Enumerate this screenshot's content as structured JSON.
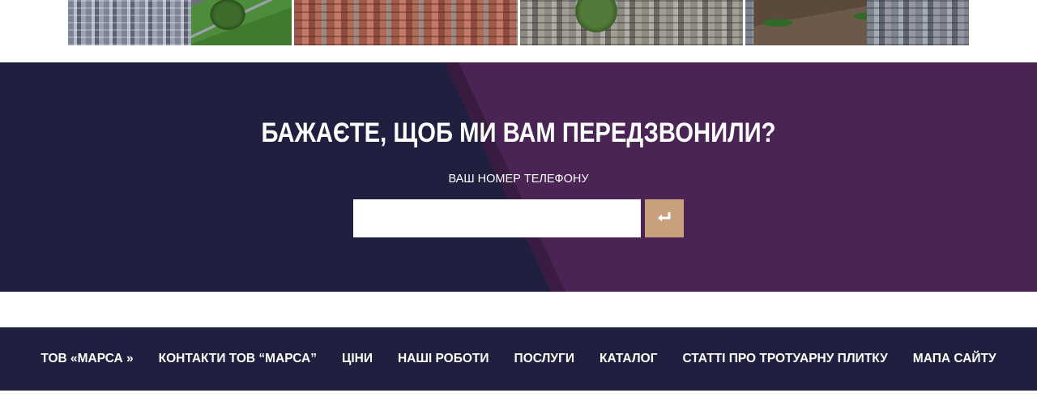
{
  "gallery": {
    "items": [
      {
        "alt_semantic": "paving-photo-gray-with-lawn"
      },
      {
        "alt_semantic": "paving-photo-red-brick"
      },
      {
        "alt_semantic": "paving-photo-gray-with-tree"
      },
      {
        "alt_semantic": "paving-photo-gray-with-shrubs"
      }
    ]
  },
  "callback": {
    "title": "БАЖАЄТЕ, ЩОБ МИ ВАМ ПЕРЕДЗВОНИЛИ?",
    "phone_label": "ВАШ НОМЕР ТЕЛЕФОНУ",
    "phone_value": "",
    "submit_icon": "enter-arrow-icon",
    "colors": {
      "left_bg": "#1f1f40",
      "right_bg": "#4a2454",
      "button_bg": "#c8a07c"
    }
  },
  "footer": {
    "colors": {
      "bg": "#1f1f40",
      "text": "#ffffff"
    },
    "nav": [
      {
        "label": "ТОВ «МАРСА »"
      },
      {
        "label": "КОНТАКТИ ТОВ “МАРСА”"
      },
      {
        "label": "ЦІНИ"
      },
      {
        "label": "НАШІ РОБОТИ"
      },
      {
        "label": "ПОСЛУГИ"
      },
      {
        "label": "КАТАЛОГ"
      },
      {
        "label": "СТАТТІ ПРО ТРОТУАРНУ ПЛИТКУ"
      },
      {
        "label": "МАПА САЙТУ"
      }
    ]
  }
}
